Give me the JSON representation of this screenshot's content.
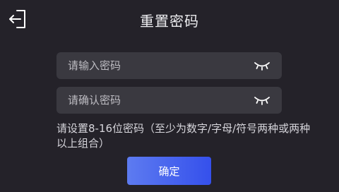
{
  "header": {
    "back_icon": "exit-icon",
    "title": "重置密码"
  },
  "form": {
    "password": {
      "placeholder": "请输入密码",
      "value": "",
      "toggle_icon": "eye-closed-icon"
    },
    "confirm_password": {
      "placeholder": "请确认密码",
      "value": "",
      "toggle_icon": "eye-closed-icon"
    },
    "hint": "请设置8-16位密码（至少为数字/字母/符号两种或两种以上组合）"
  },
  "actions": {
    "confirm_label": "确定"
  },
  "colors": {
    "background": "#242229",
    "field": "#3a3940",
    "accent_start": "#5d7bf0",
    "accent_end": "#3550ec"
  }
}
